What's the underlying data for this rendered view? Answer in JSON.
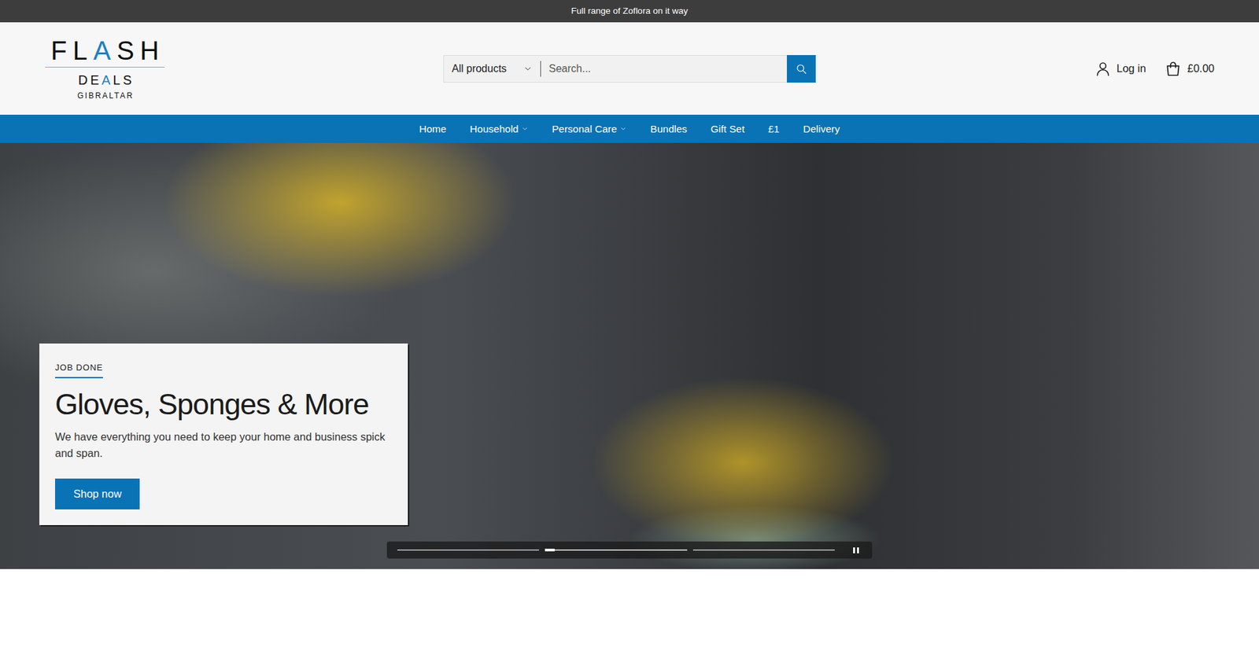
{
  "announcement": {
    "text": "Full range of Zoflora on it way"
  },
  "logo": {
    "line1": [
      {
        "text": "FL",
        "accent": false
      },
      {
        "text": "A",
        "accent": true
      },
      {
        "text": "SH",
        "accent": false
      }
    ],
    "line2": [
      {
        "text": "DE",
        "accent": false
      },
      {
        "text": "A",
        "accent": true
      },
      {
        "text": "LS",
        "accent": false
      }
    ],
    "line3": "GIBRALTAR"
  },
  "search": {
    "category": "All products",
    "placeholder": "Search..."
  },
  "account": {
    "label": "Log in"
  },
  "cart": {
    "total": "£0.00"
  },
  "nav": [
    {
      "label": "Home",
      "has_menu": false
    },
    {
      "label": "Household",
      "has_menu": true
    },
    {
      "label": "Personal Care",
      "has_menu": true
    },
    {
      "label": "Bundles",
      "has_menu": false
    },
    {
      "label": "Gift Set",
      "has_menu": false
    },
    {
      "label": "£1",
      "has_menu": false
    },
    {
      "label": "Delivery",
      "has_menu": false
    }
  ],
  "hero": {
    "eyebrow": "JOB DONE",
    "title": "Gloves, Sponges & More",
    "text": "We have everything you need to keep your home and business spick and span.",
    "button": "Shop now"
  },
  "slider": {
    "slides": [
      {
        "selected": false,
        "level": 0
      },
      {
        "selected": true,
        "level": 0.07
      },
      {
        "selected": false,
        "level": 0
      }
    ],
    "paused": false
  }
}
